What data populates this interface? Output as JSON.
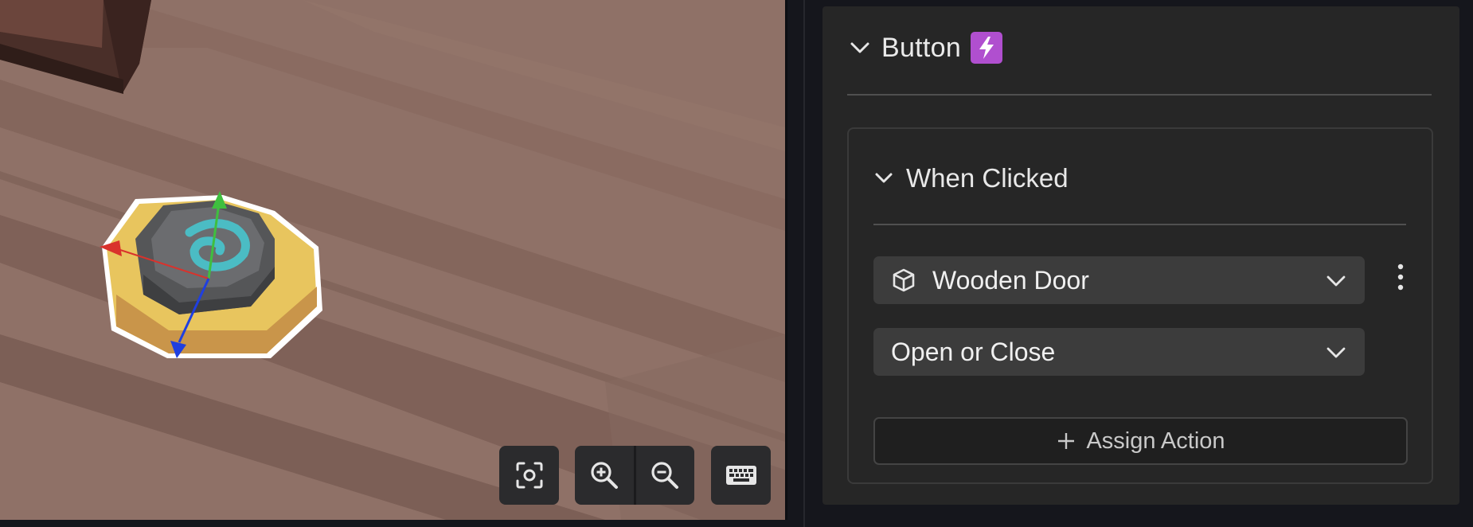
{
  "panel": {
    "component_title": "Button",
    "component_badge_icon": "lightning-bolt-icon",
    "event": {
      "title": "When Clicked",
      "target_object": "Wooden Door",
      "target_object_icon": "cube-icon",
      "action": "Open or Close",
      "assign_label": "Assign Action",
      "more_icon": "kebab-menu-icon"
    }
  },
  "viewport": {
    "controls": [
      {
        "name": "focus-button",
        "icon": "focus-frame-icon"
      },
      {
        "name": "zoom-in-button",
        "icon": "zoom-in-icon"
      },
      {
        "name": "zoom-out-button",
        "icon": "zoom-out-icon"
      },
      {
        "name": "keyboard-button",
        "icon": "keyboard-icon"
      }
    ]
  },
  "colors": {
    "accent_purple": "#b04fcf",
    "panel_bg": "#262626",
    "select_bg": "#3c3c3c",
    "floor": "#8f7167",
    "button_gold": "#e8c55e",
    "gizmo_x": "#d9322c",
    "gizmo_y": "#3fbf3f",
    "gizmo_z": "#1f3fe0"
  }
}
